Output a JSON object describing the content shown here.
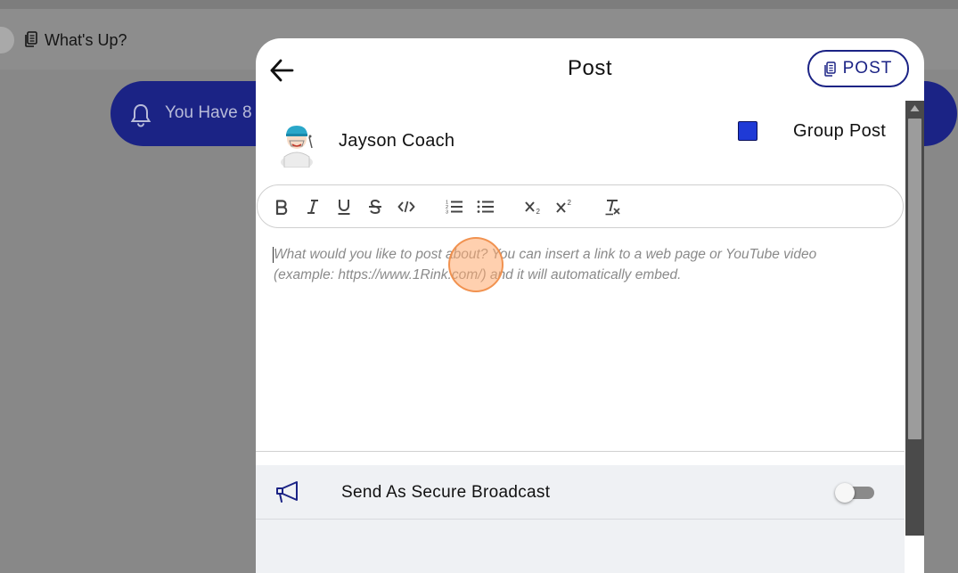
{
  "background": {
    "header_title": "What's Up?",
    "banner_text": "You Have 8"
  },
  "modal": {
    "title": "Post",
    "post_button_label": "POST",
    "author_name": "Jayson Coach",
    "group_post": {
      "label": "Group Post",
      "checked": true
    },
    "toolbar": {
      "buttons": [
        "bold",
        "italic",
        "underline",
        "strikethrough",
        "code",
        "ordered-list",
        "bullet-list",
        "subscript",
        "superscript",
        "clear-formatting"
      ]
    },
    "editor_placeholder": "What would you like to post about? You can insert a link to a web page or YouTube video (example: https://www.1Rink.com/) and it will automatically embed.",
    "secure_broadcast": {
      "label": "Send As Secure Broadcast",
      "enabled": false
    }
  },
  "colors": {
    "brand_navy": "#1b2385",
    "checkbox_blue": "#1f3ad6",
    "row_background": "#eff1f4"
  },
  "icons": {
    "back": "arrow-left-icon",
    "post": "document-icon",
    "broadcast": "megaphone-icon",
    "notification": "bell-icon"
  }
}
